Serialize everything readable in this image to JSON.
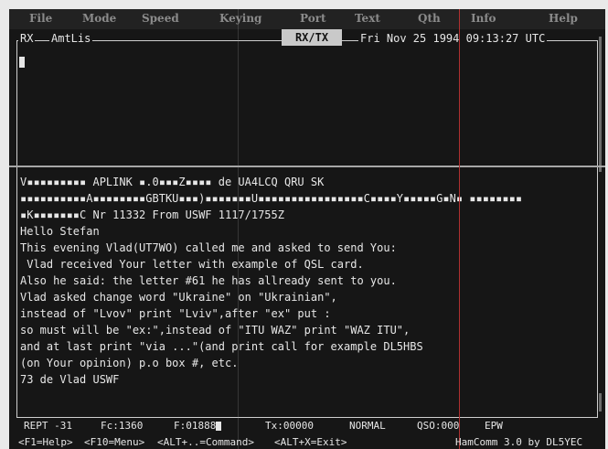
{
  "menu": [
    "File",
    "Mode",
    "Speed",
    "Keying",
    "Port",
    "Text",
    "Qth",
    "Info",
    "Help"
  ],
  "tabs": {
    "rx": "RX",
    "amtlist": "AmtLis"
  },
  "center_title": "RX/TX",
  "clock": "Fri Nov 25 1994 09:13:27 UTC",
  "tx_lines": [
    "V▪▪▪▪▪▪▪▪▪ APLINK ▪.0▪▪▪Z▪▪▪▪ de UA4LCQ QRU SK",
    "▪▪▪▪▪▪▪▪▪▪A▪▪▪▪▪▪▪▪GBTKU▪▪▪)▪▪▪▪▪▪▪U▪▪▪▪▪▪▪▪▪▪▪▪▪▪▪▪C▪▪▪▪Y▪▪▪▪▪G▪N▪ ▪▪▪▪▪▪▪▪",
    "▪K▪▪▪▪▪▪▪C Nr 11332 From USWF 1117/1755Z",
    "Hello Stefan",
    "This evening Vlad(UT7WO) called me and asked to send You:",
    " Vlad received Your letter with example of QSL card.",
    "Also he said: the letter #61 he has allready sent to you.",
    "Vlad asked change word \"Ukraine\" on \"Ukrainian\",",
    "instead of \"Lvov\" print \"Lviv\",after \"ex\" put :",
    "so must will be \"ex:\",instead of \"ITU WAZ\" print \"WAZ ITU\",",
    "and at last print \"via ...\"(and print call for example DL5HBS",
    "(on Your opinion) p.o box #, etc.",
    "73 de Vlad USWF"
  ],
  "status": {
    "rept": "REPT -31",
    "fc": "Fc:1360",
    "f": "F:01888",
    "tx": "Tx:00000",
    "mode": "NORMAL",
    "qso": "QSO:000",
    "epw": "EPW"
  },
  "hints": {
    "help": "<F1=Help>",
    "menu": "<F10=Menu>",
    "command": "<ALT+..=Command>",
    "exit": "<ALT+X=Exit>",
    "program": "HamComm 3.0 by DL5YEC"
  },
  "colors": {
    "screen_bg": "#161616",
    "text": "#e6e6e6",
    "menu_text": "#8b8b8b",
    "accent_line": "#d23a3a"
  }
}
